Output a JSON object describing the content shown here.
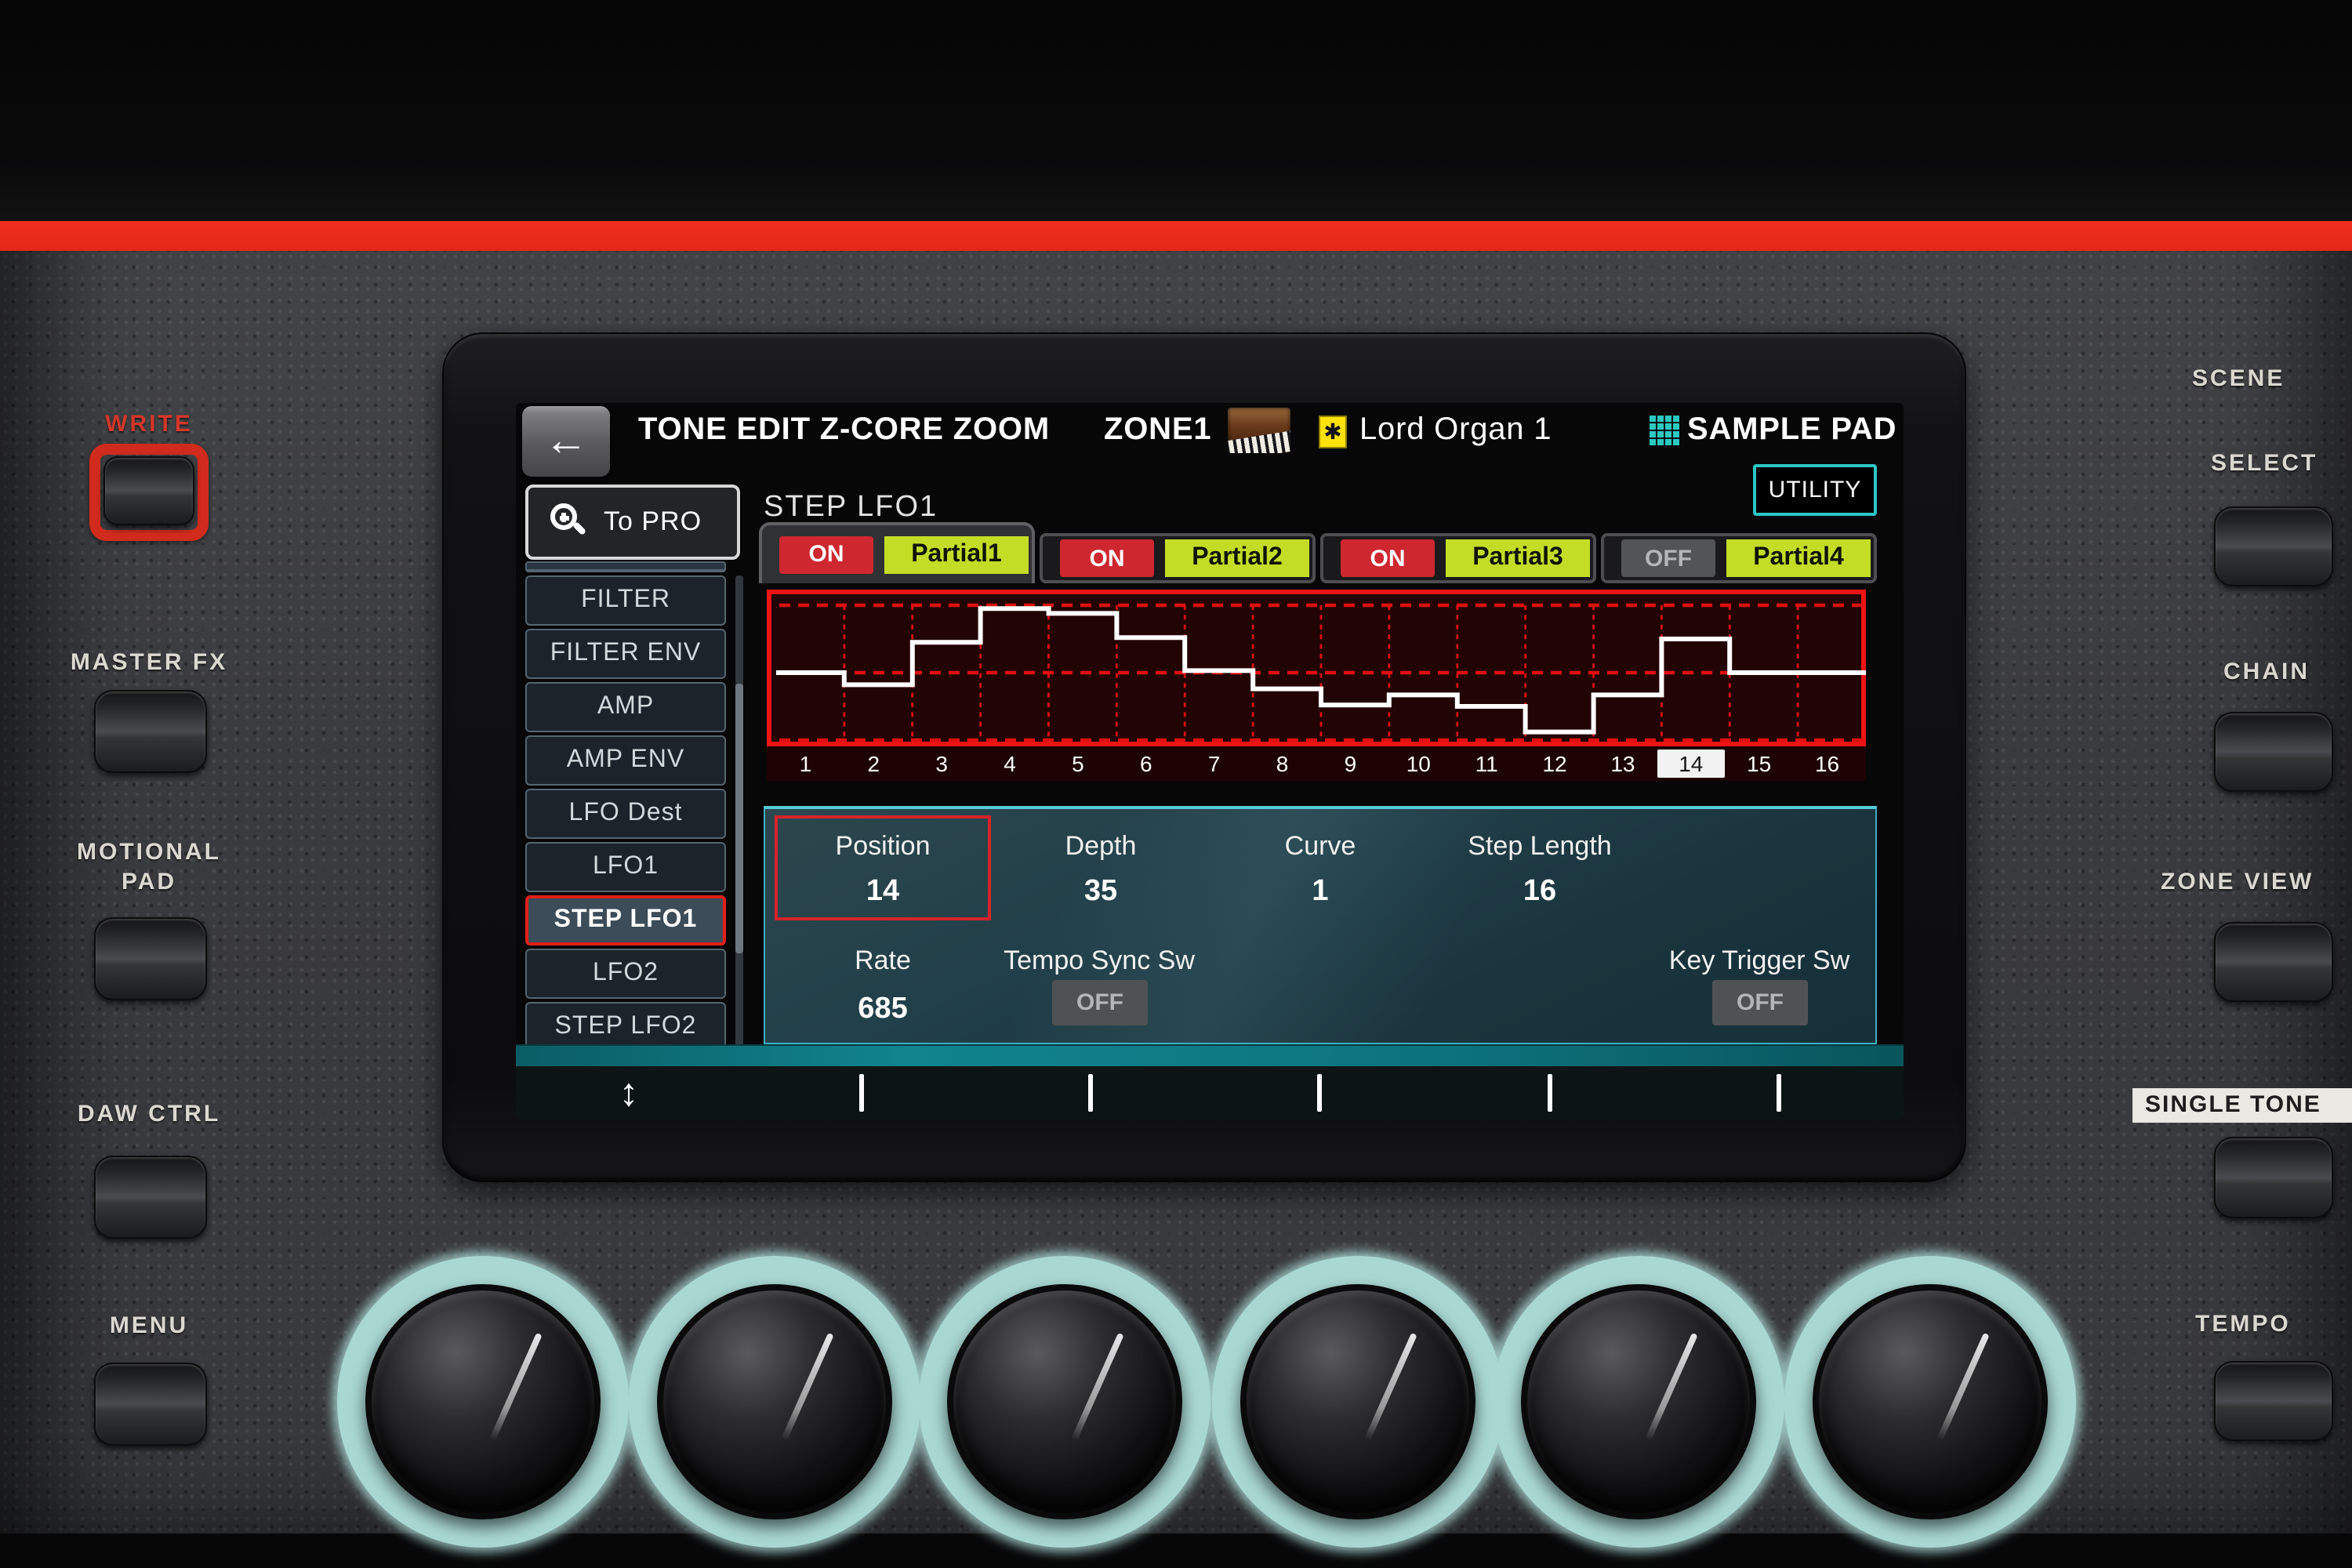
{
  "screen": {
    "topbar": {
      "back_icon": "←",
      "title": "TONE EDIT Z-CORE ZOOM",
      "zone_label": "ZONE1",
      "tone_badge_icon": "✱",
      "tone_name": "Lord Organ 1",
      "sample_pad_label": "SAMPLE PAD"
    },
    "utility_button": "UTILITY",
    "page_title": "STEP LFO1",
    "to_pro_button": "To PRO",
    "sidebar": {
      "items": [
        "FILTER",
        "FILTER ENV",
        "AMP",
        "AMP ENV",
        "LFO Dest",
        "LFO1",
        "STEP LFO1",
        "LFO2",
        "STEP LFO2"
      ],
      "selected": "STEP LFO1"
    },
    "partial_tabs": [
      {
        "switch": "ON",
        "label": "Partial1",
        "on": true,
        "selected": true
      },
      {
        "switch": "ON",
        "label": "Partial2",
        "on": true,
        "selected": false
      },
      {
        "switch": "ON",
        "label": "Partial3",
        "on": true,
        "selected": false
      },
      {
        "switch": "OFF",
        "label": "Partial4",
        "on": false,
        "selected": false
      }
    ],
    "chart_data": {
      "type": "step-line",
      "title": "STEP LFO1 pattern",
      "x_ticks": [
        "1",
        "2",
        "3",
        "4",
        "5",
        "6",
        "7",
        "8",
        "9",
        "10",
        "11",
        "12",
        "13",
        "14",
        "15",
        "16"
      ],
      "values_pct": [
        0,
        -18,
        45,
        95,
        88,
        52,
        3,
        -24,
        -48,
        -33,
        -50,
        -88,
        -33,
        50,
        0,
        0
      ],
      "ylim": [
        -100,
        100
      ],
      "selected_step": 14,
      "grid": "red-dashed",
      "line_color": "#ffffff",
      "grid_color": "#e01010",
      "background": "#230404"
    },
    "params": {
      "position": {
        "label": "Position",
        "value": "14",
        "selected": true
      },
      "depth": {
        "label": "Depth",
        "value": "35"
      },
      "curve": {
        "label": "Curve",
        "value": "1"
      },
      "step_length": {
        "label": "Step Length",
        "value": "16"
      },
      "rate": {
        "label": "Rate",
        "value": "685"
      },
      "tempo_sync": {
        "label": "Tempo Sync Sw",
        "value": "OFF"
      },
      "key_trigger": {
        "label": "Key Trigger Sw",
        "value": "OFF"
      }
    },
    "function_bar": {
      "scroll_icon": "↕",
      "dividers": 5
    }
  },
  "hardware": {
    "left_controls": [
      {
        "label": "WRITE",
        "accent": "red"
      },
      {
        "label": "MASTER FX"
      },
      {
        "label": "MOTIONAL PAD",
        "line1": "MOTIONAL",
        "line2": "PAD"
      },
      {
        "label": "DAW CTRL"
      },
      {
        "label": "MENU"
      }
    ],
    "right_controls": [
      {
        "label": "SCENE"
      },
      {
        "label": "SELECT"
      },
      {
        "label": "CHAIN"
      },
      {
        "label": "ZONE VIEW"
      },
      {
        "label": "SINGLE TONE",
        "highlighted": true
      },
      {
        "label": "TEMPO"
      }
    ],
    "knob_count": 6
  },
  "colors": {
    "housing_red": "#e02415",
    "lcd_grid_red": "#e01010",
    "partial_yellow": "#c3dd26",
    "switch_on_red": "#ce2730",
    "screen_teal": "#2cc6c6",
    "knob_glow": "#a9d8d3"
  }
}
